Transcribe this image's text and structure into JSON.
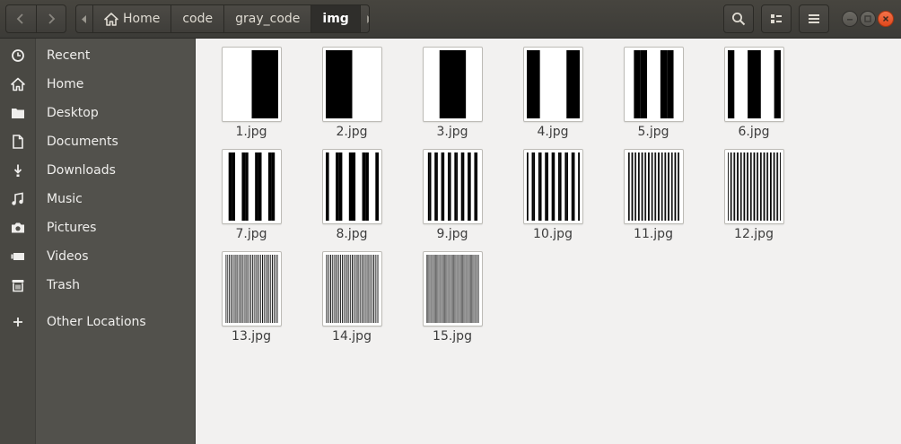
{
  "window": {
    "path": {
      "items": [
        {
          "label": "Home",
          "icon": "home-icon"
        },
        {
          "label": "code"
        },
        {
          "label": "gray_code"
        },
        {
          "label": "img"
        }
      ]
    },
    "buttons": {
      "search": "search-icon",
      "view": "list-view-icon",
      "menu": "hamburger-menu-icon"
    },
    "colors": {
      "accent_close": "#e9541f",
      "sidebar": "#52514c",
      "content": "#f2f1f0"
    }
  },
  "sidebar": {
    "items": [
      {
        "label": "Recent",
        "icon": "clock-icon"
      },
      {
        "label": "Home",
        "icon": "home-icon"
      },
      {
        "label": "Desktop",
        "icon": "folder-icon"
      },
      {
        "label": "Documents",
        "icon": "document-icon"
      },
      {
        "label": "Downloads",
        "icon": "download-icon"
      },
      {
        "label": "Music",
        "icon": "music-icon"
      },
      {
        "label": "Pictures",
        "icon": "camera-icon"
      },
      {
        "label": "Videos",
        "icon": "video-icon"
      },
      {
        "label": "Trash",
        "icon": "trash-icon"
      },
      {
        "label": "Other Locations",
        "icon": "plus-icon"
      }
    ]
  },
  "files": [
    {
      "name": "1.jpg",
      "stripes": 1
    },
    {
      "name": "2.jpg",
      "stripes": 1
    },
    {
      "name": "3.jpg",
      "stripes": 2
    },
    {
      "name": "4.jpg",
      "stripes": 2
    },
    {
      "name": "5.jpg",
      "stripes": 4
    },
    {
      "name": "6.jpg",
      "stripes": 4
    },
    {
      "name": "7.jpg",
      "stripes": 8
    },
    {
      "name": "8.jpg",
      "stripes": 8
    },
    {
      "name": "9.jpg",
      "stripes": 16
    },
    {
      "name": "10.jpg",
      "stripes": 16
    },
    {
      "name": "11.jpg",
      "stripes": 32
    },
    {
      "name": "12.jpg",
      "stripes": 32
    },
    {
      "name": "13.jpg",
      "stripes": 64
    },
    {
      "name": "14.jpg",
      "stripes": 64
    },
    {
      "name": "15.jpg",
      "stripes": 128
    }
  ]
}
